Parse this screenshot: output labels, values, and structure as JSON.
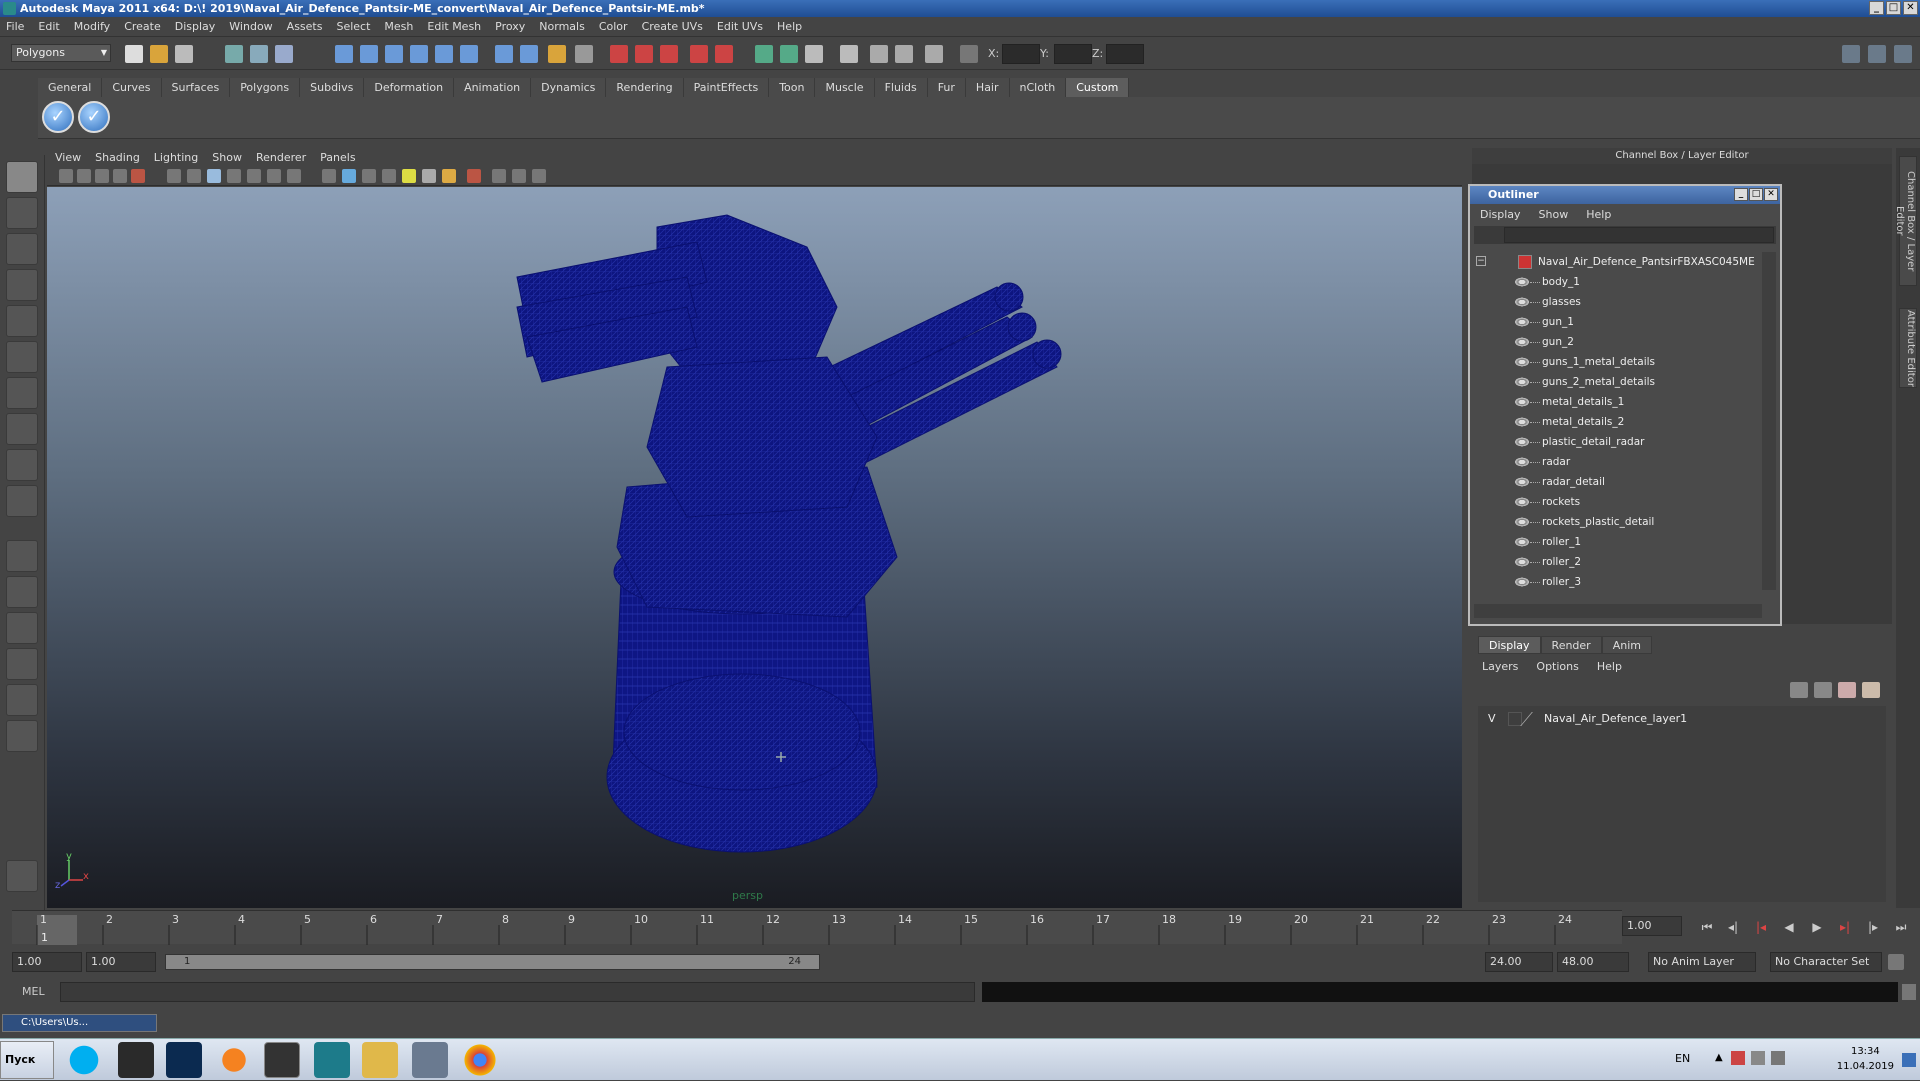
{
  "window": {
    "title": "Autodesk Maya 2011 x64: D:\\! 2019\\Naval_Air_Defence_Pantsir-ME_convert\\Naval_Air_Defence_Pantsir-ME.mb*"
  },
  "menubar": [
    "File",
    "Edit",
    "Modify",
    "Create",
    "Display",
    "Window",
    "Assets",
    "Select",
    "Mesh",
    "Edit Mesh",
    "Proxy",
    "Normals",
    "Color",
    "Create UVs",
    "Edit UVs",
    "Help"
  ],
  "status_line": {
    "mode": "Polygons",
    "x_label": "X:",
    "y_label": "Y:",
    "z_label": "Z:"
  },
  "shelf_tabs": [
    "General",
    "Curves",
    "Surfaces",
    "Polygons",
    "Subdivs",
    "Deformation",
    "Animation",
    "Dynamics",
    "Rendering",
    "PaintEffects",
    "Toon",
    "Muscle",
    "Fluids",
    "Fur",
    "Hair",
    "nCloth",
    "Custom"
  ],
  "shelf_active_tab": "Custom",
  "viewport": {
    "menu": [
      "View",
      "Shading",
      "Lighting",
      "Show",
      "Renderer",
      "Panels"
    ],
    "camera_label": "persp",
    "axis_y": "y",
    "axis_x": "x",
    "axis_z": "z"
  },
  "channel_box": {
    "header": "Channel Box / Layer Editor",
    "side_tab_1": "Channel Box / Layer Editor",
    "side_tab_2": "Attribute Editor"
  },
  "outliner": {
    "title": "Outliner",
    "menu": [
      "Display",
      "Show",
      "Help"
    ],
    "root": "Naval_Air_Defence_PantsirFBXASC045ME",
    "items": [
      "body_1",
      "glasses",
      "gun_1",
      "gun_2",
      "guns_1_metal_details",
      "guns_2_metal_details",
      "metal_details_1",
      "metal_details_2",
      "plastic_detail_radar",
      "radar",
      "radar_detail",
      "rockets",
      "rockets_plastic_detail",
      "roller_1",
      "roller_2",
      "roller_3"
    ]
  },
  "layer_editor": {
    "tabs": [
      "Display",
      "Render",
      "Anim"
    ],
    "active_tab": "Display",
    "menu": [
      "Layers",
      "Options",
      "Help"
    ],
    "layers": [
      {
        "visible": "V",
        "name": "Naval_Air_Defence_layer1"
      }
    ]
  },
  "time_slider": {
    "ticks": [
      "1",
      "2",
      "3",
      "4",
      "5",
      "6",
      "7",
      "8",
      "9",
      "10",
      "11",
      "12",
      "13",
      "14",
      "15",
      "16",
      "17",
      "18",
      "19",
      "20",
      "21",
      "22",
      "23",
      "24"
    ],
    "current_frame_marker": "1",
    "current_time": "1.00"
  },
  "range_slider": {
    "start_time": "1.00",
    "playback_start": "1.00",
    "range_start_label": "1",
    "range_end_label": "24",
    "playback_end": "24.00",
    "end_time": "48.00",
    "anim_layer": "No Anim Layer",
    "character_set": "No Character Set"
  },
  "command_line": {
    "label": "MEL"
  },
  "minimized_window": {
    "title": "C:\\Users\\Us..."
  },
  "taskbar": {
    "start_label": "Пуск",
    "language": "EN",
    "time": "13:34",
    "date": "11.04.2019"
  }
}
